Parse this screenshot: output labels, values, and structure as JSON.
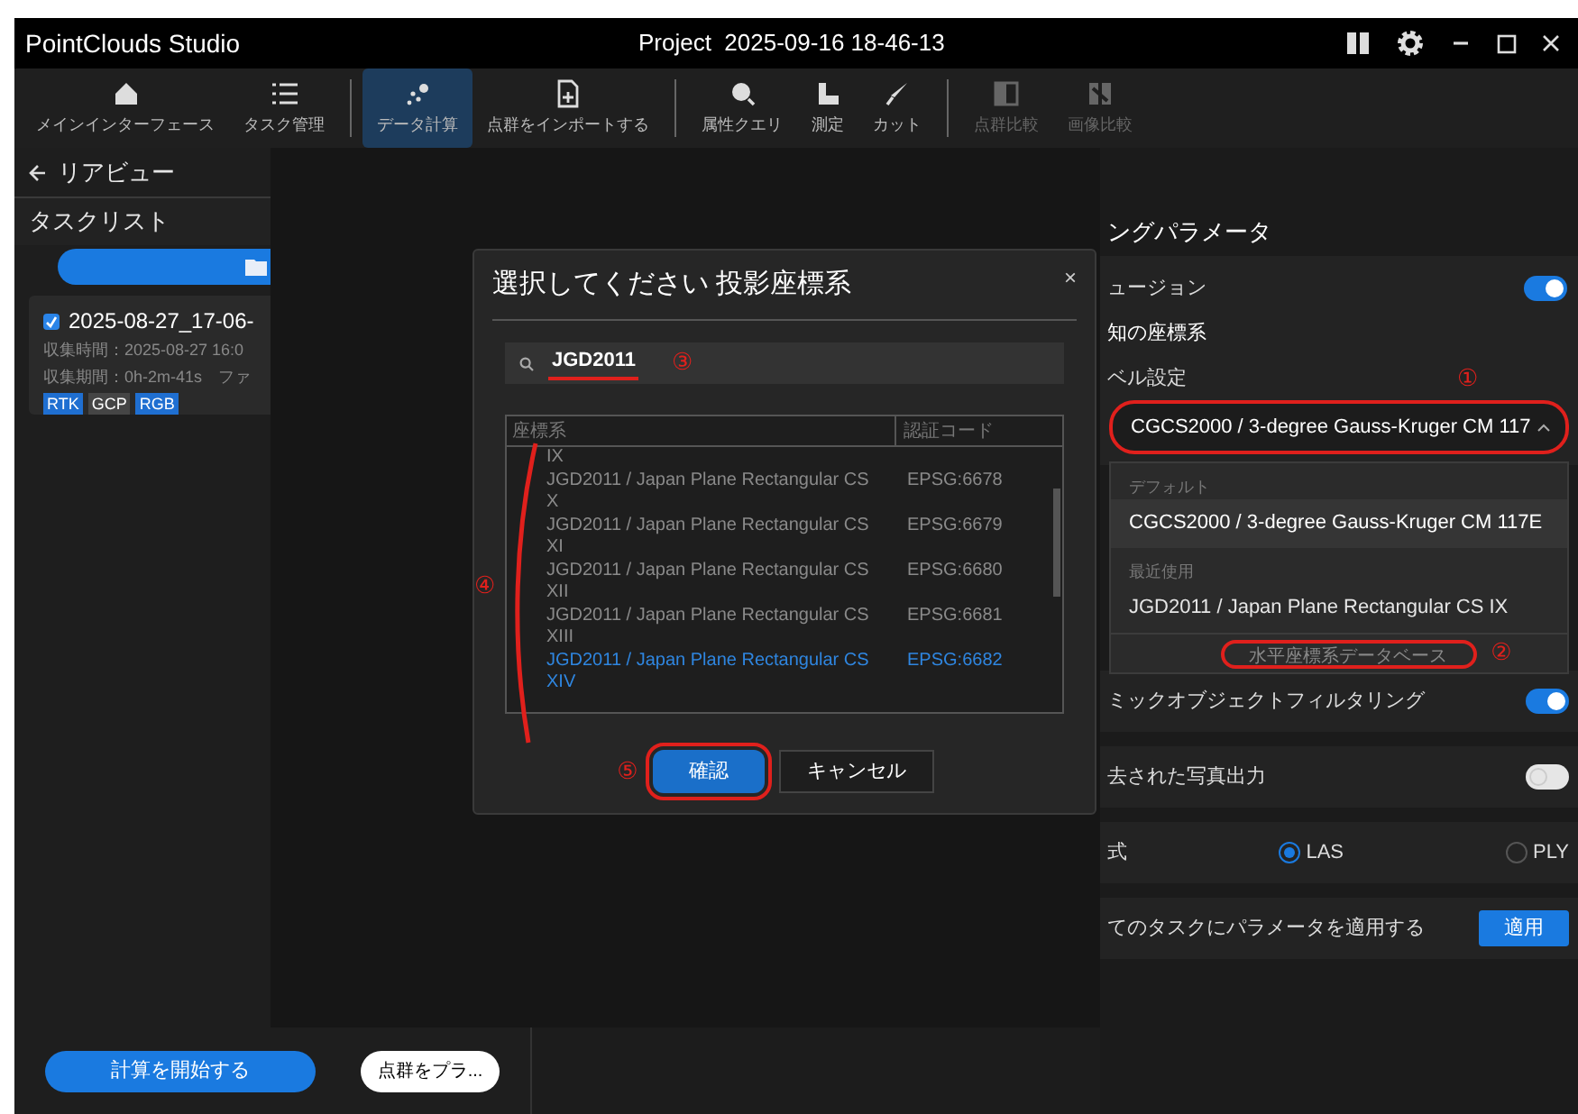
{
  "window": {
    "title": "PointClouds Studio",
    "project": "Project  2025-09-16 18-46-13"
  },
  "toolbar": [
    {
      "label": "メインインターフェース",
      "kind": "home",
      "selected": false,
      "disabled": false
    },
    {
      "label": "タスク管理",
      "kind": "list",
      "selected": false,
      "disabled": false
    },
    {
      "label": "データ計算",
      "kind": "compute",
      "selected": true,
      "disabled": false
    },
    {
      "label": "点群をインポートする",
      "kind": "import",
      "selected": false,
      "disabled": false
    },
    {
      "label": "属性クエリ",
      "kind": "query",
      "selected": false,
      "disabled": false
    },
    {
      "label": "測定",
      "kind": "measure",
      "selected": false,
      "disabled": false
    },
    {
      "label": "カット",
      "kind": "cut",
      "selected": false,
      "disabled": false
    },
    {
      "label": "点群比較",
      "kind": "compare",
      "selected": false,
      "disabled": true
    },
    {
      "label": "画像比較",
      "kind": "image_compare",
      "selected": false,
      "disabled": true
    }
  ],
  "left_panel": {
    "back": "リアビュー",
    "title": "タスクリスト",
    "tasks": [
      {
        "name": "2025-08-27_17-06-",
        "checked": true,
        "lines": [
          "収集時間：2025-08-27 16:0",
          "収集期間：0h-2m-41s　ファ"
        ],
        "tags": [
          {
            "label": "RTK",
            "color": "#1f6fd1"
          },
          {
            "label": "GCP",
            "color": "#454545"
          },
          {
            "label": "RGB",
            "color": "#1f6fd1"
          }
        ]
      }
    ],
    "start_button": "計算を開始する",
    "preview_button": "点群をプラ..."
  },
  "right_panel": {
    "title": "ングパラメータ",
    "fusion": {
      "label": "ュージョン",
      "on": true
    },
    "coordinate_label": "知の座標系",
    "level_label": "ベル設定",
    "coordinate_select": {
      "value": "CGCS2000 / 3-degree Gauss-Kruger CM 117",
      "expanded": true,
      "annotation": "①",
      "highlighted": true
    },
    "menu": {
      "groups": [
        {
          "title": "デフォルト",
          "items": [
            {
              "label": "CGCS2000 / 3-degree Gauss-Kruger CM 117E",
              "selected": true
            }
          ]
        },
        {
          "title": "最近使用",
          "items": [
            {
              "label": "JGD2011 / Japan Plane Rectangular CS IX",
              "selected": false
            }
          ]
        }
      ],
      "database_link": {
        "label": "水平座標系データベース",
        "annotation": "②",
        "highlighted": true
      }
    },
    "rows": [
      {
        "kind": "toggle",
        "label": "ミックオブジェクトフィルタリング",
        "on": true
      },
      {
        "kind": "toggle",
        "label": "去された写真出力",
        "on": false
      },
      {
        "kind": "radio",
        "label": "式",
        "options": [
          {
            "label": "LAS",
            "selected": true
          },
          {
            "label": "PLY",
            "selected": false
          }
        ]
      },
      {
        "kind": "button",
        "label": "てのタスクにパラメータを適用する",
        "button": "適用"
      }
    ]
  },
  "dialog": {
    "title": "選択してください 投影座標系",
    "close": "×",
    "search": {
      "value": "JGD2011",
      "annotation": "③",
      "underlined": true
    },
    "table": {
      "columns": [
        "座標系",
        "認証コード"
      ],
      "annotation": "④",
      "rows": [
        {
          "name": "IX",
          "selected": false
        },
        {
          "name": "JGD2011 / Japan Plane Rectangular CS X",
          "code": "EPSG:6678",
          "selected": false
        },
        {
          "name": "JGD2011 / Japan Plane Rectangular CS XI",
          "code": "EPSG:6679",
          "selected": false
        },
        {
          "name": "JGD2011 / Japan Plane Rectangular CS XII",
          "code": "EPSG:6680",
          "selected": false
        },
        {
          "name": "JGD2011 / Japan Plane Rectangular CS XIII",
          "code": "EPSG:6681",
          "selected": false
        },
        {
          "name": "JGD2011 / Japan Plane Rectangular CS XIV",
          "code": "EPSG:6682",
          "selected": true
        }
      ]
    },
    "confirm": {
      "label": "確認",
      "annotation": "⑤",
      "highlighted": true
    },
    "cancel": "キャンセル"
  }
}
